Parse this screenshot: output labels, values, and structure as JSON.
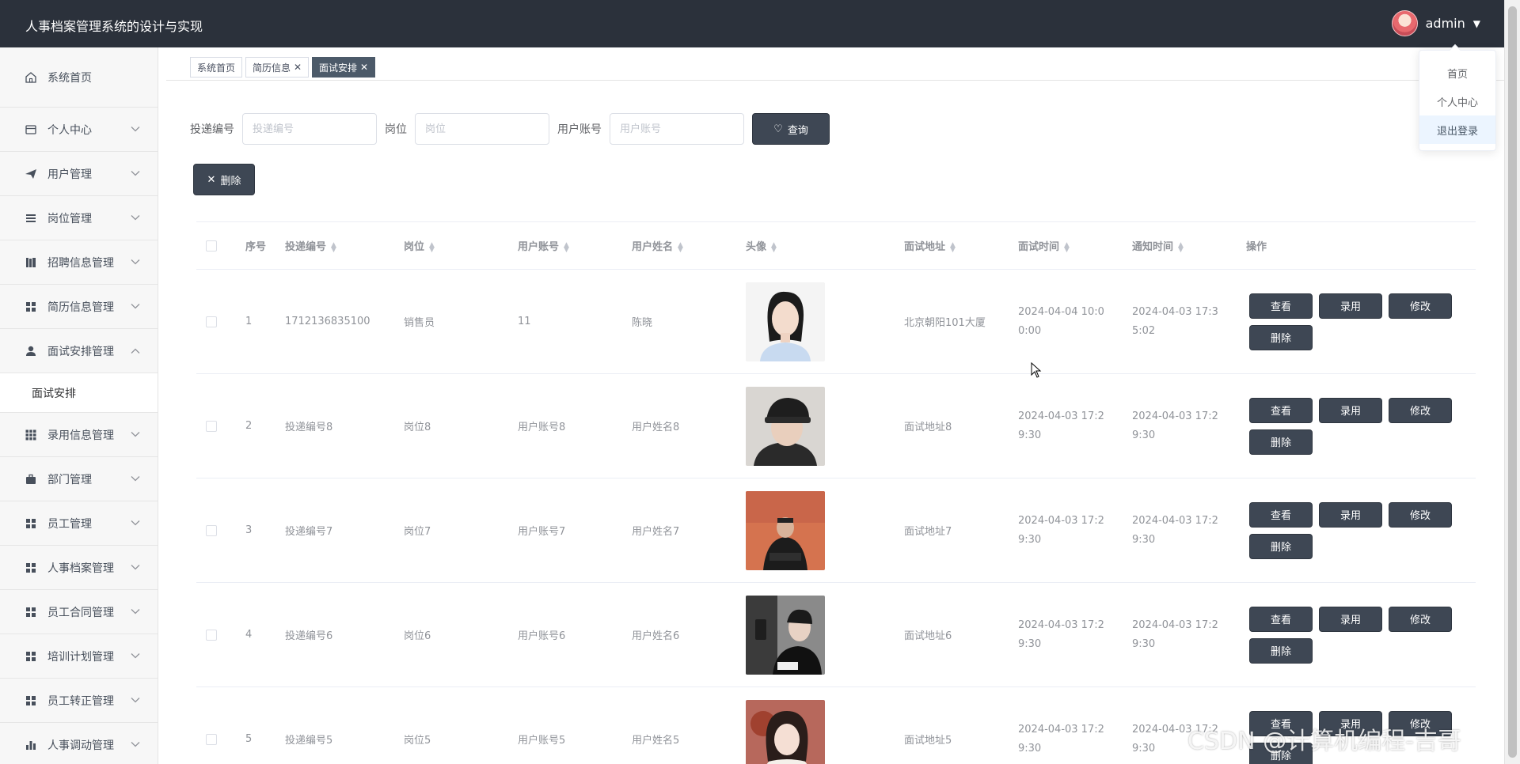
{
  "header": {
    "title": "人事档案管理系统的设计与实现",
    "username": "admin"
  },
  "user_menu": {
    "items": [
      "首页",
      "个人中心",
      "退出登录"
    ],
    "highlighted": "退出登录"
  },
  "sidebar": {
    "items": [
      {
        "label": "系统首页",
        "icon": "home-icon",
        "has_children": false
      },
      {
        "label": "个人中心",
        "icon": "card-icon",
        "has_children": true
      },
      {
        "label": "用户管理",
        "icon": "paper-plane-icon",
        "has_children": true
      },
      {
        "label": "岗位管理",
        "icon": "list-icon",
        "has_children": true
      },
      {
        "label": "招聘信息管理",
        "icon": "book-icon",
        "has_children": true
      },
      {
        "label": "简历信息管理",
        "icon": "grid-icon",
        "has_children": true
      },
      {
        "label": "面试安排管理",
        "icon": "user-icon",
        "has_children": true,
        "open": true
      },
      {
        "label": "录用信息管理",
        "icon": "grid9-icon",
        "has_children": true
      },
      {
        "label": "部门管理",
        "icon": "briefcase-icon",
        "has_children": true
      },
      {
        "label": "员工管理",
        "icon": "grid-icon",
        "has_children": true
      },
      {
        "label": "人事档案管理",
        "icon": "grid-icon",
        "has_children": true
      },
      {
        "label": "员工合同管理",
        "icon": "grid-icon",
        "has_children": true
      },
      {
        "label": "培训计划管理",
        "icon": "grid-icon",
        "has_children": true
      },
      {
        "label": "员工转正管理",
        "icon": "grid-icon",
        "has_children": true
      },
      {
        "label": "人事调动管理",
        "icon": "bar-chart-icon",
        "has_children": true
      }
    ],
    "open_submenu": "面试安排"
  },
  "tabs": [
    {
      "label": "系统首页",
      "closable": false,
      "active": false
    },
    {
      "label": "简历信息",
      "closable": true,
      "active": false
    },
    {
      "label": "面试安排",
      "closable": true,
      "active": true
    }
  ],
  "search": {
    "fields": [
      {
        "label": "投递编号",
        "placeholder": "投递编号",
        "value": ""
      },
      {
        "label": "岗位",
        "placeholder": "岗位",
        "value": ""
      },
      {
        "label": "用户账号",
        "placeholder": "用户账号",
        "value": ""
      }
    ],
    "query_label": "查询",
    "delete_label": "删除"
  },
  "table": {
    "columns": [
      "序号",
      "投递编号",
      "岗位",
      "用户账号",
      "用户姓名",
      "头像",
      "面试地址",
      "面试时间",
      "通知时间",
      "操作"
    ],
    "sortable": [
      false,
      true,
      true,
      true,
      true,
      true,
      true,
      true,
      true,
      false
    ],
    "actions": [
      "查看",
      "录用",
      "修改",
      "删除"
    ],
    "rows": [
      {
        "index": "1",
        "delivery_no": "1712136835100",
        "post": "销售员",
        "account": "11",
        "name": "陈晓",
        "photo": "avatar-girl-white-shirt",
        "address": "北京朝阳101大厦",
        "interview_time": "2024-04-04 10:00:00",
        "notice_time": "2024-04-03 17:35:02"
      },
      {
        "index": "2",
        "delivery_no": "投递编号8",
        "post": "岗位8",
        "account": "用户账号8",
        "name": "用户姓名8",
        "photo": "avatar-boy-cap",
        "address": "面试地址8",
        "interview_time": "2024-04-03 17:29:30",
        "notice_time": "2024-04-03 17:29:30"
      },
      {
        "index": "3",
        "delivery_no": "投递编号7",
        "post": "岗位7",
        "account": "用户账号7",
        "name": "用户姓名7",
        "photo": "avatar-orange-wall",
        "address": "面试地址7",
        "interview_time": "2024-04-03 17:29:30",
        "notice_time": "2024-04-03 17:29:30"
      },
      {
        "index": "4",
        "delivery_no": "投递编号6",
        "post": "岗位6",
        "account": "用户账号6",
        "name": "用户姓名6",
        "photo": "avatar-boy-phone",
        "address": "面试地址6",
        "interview_time": "2024-04-03 17:29:30",
        "notice_time": "2024-04-03 17:29:30"
      },
      {
        "index": "5",
        "delivery_no": "投递编号5",
        "post": "岗位5",
        "account": "用户账号5",
        "name": "用户姓名5",
        "photo": "avatar-girl-bear",
        "address": "面试地址5",
        "interview_time": "2024-04-03 17:29:30",
        "notice_time": "2024-04-03 17:29:30"
      }
    ]
  },
  "watermark": "CSDN @计算机编程-吉哥",
  "colors": {
    "header_bg": "#2b313b",
    "button_bg": "#3e4754",
    "active_tab": "#4c5a69",
    "sidebar_bg": "#f7f7f7"
  }
}
